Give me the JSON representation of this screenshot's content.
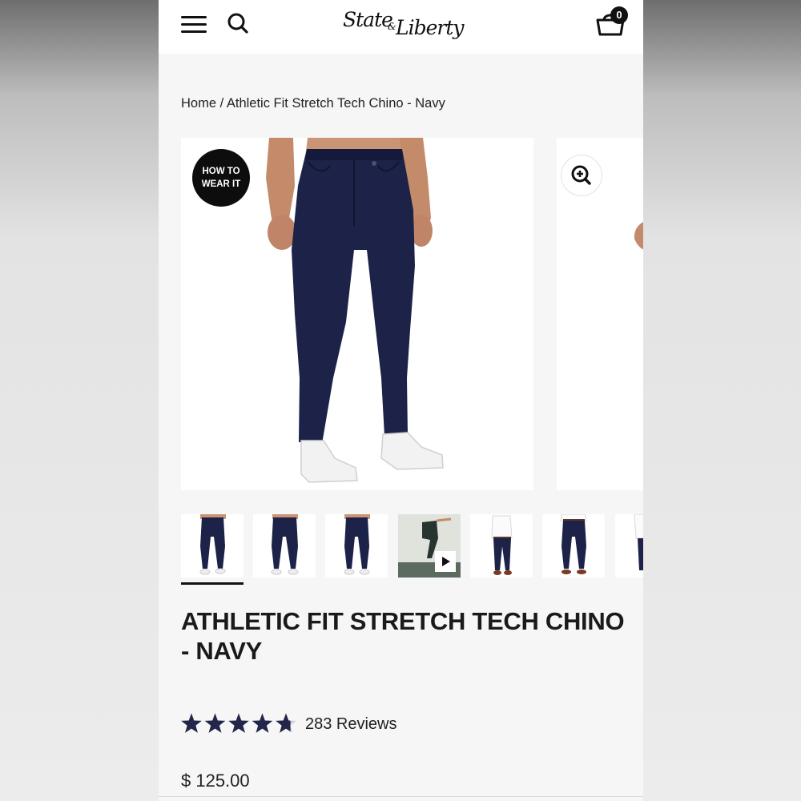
{
  "header": {
    "logo_line1": "State",
    "logo_amp": "&",
    "logo_line2": "Liberty",
    "cart_count": "0",
    "icons": [
      "hamburger-menu-icon",
      "search-icon",
      "shopping-bag-icon"
    ]
  },
  "breadcrumb": {
    "home": "Home",
    "separator": " / ",
    "current": "Athletic Fit Stretch Tech Chino - Navy"
  },
  "gallery": {
    "badge_line1": "HOW TO",
    "badge_line2": "WEAR IT",
    "zoom_icon": "zoom-in-icon",
    "thumbnails": [
      {
        "kind": "pants-front",
        "active": true
      },
      {
        "kind": "pants-front"
      },
      {
        "kind": "pants-front"
      },
      {
        "kind": "video",
        "play_icon": "play-icon"
      },
      {
        "kind": "outfit-white-shirt"
      },
      {
        "kind": "outfit-white-shirt"
      },
      {
        "kind": "outfit-partial"
      }
    ]
  },
  "product": {
    "title": "ATHLETIC FIT STRETCH TECH CHINO - NAVY",
    "rating": 4.7,
    "rating_max": 5,
    "reviews_label": "283 Reviews",
    "price": "$ 125.00"
  },
  "colors": {
    "navy": "#1c2248",
    "star": "#23254a",
    "text": "#1a1a1a"
  }
}
